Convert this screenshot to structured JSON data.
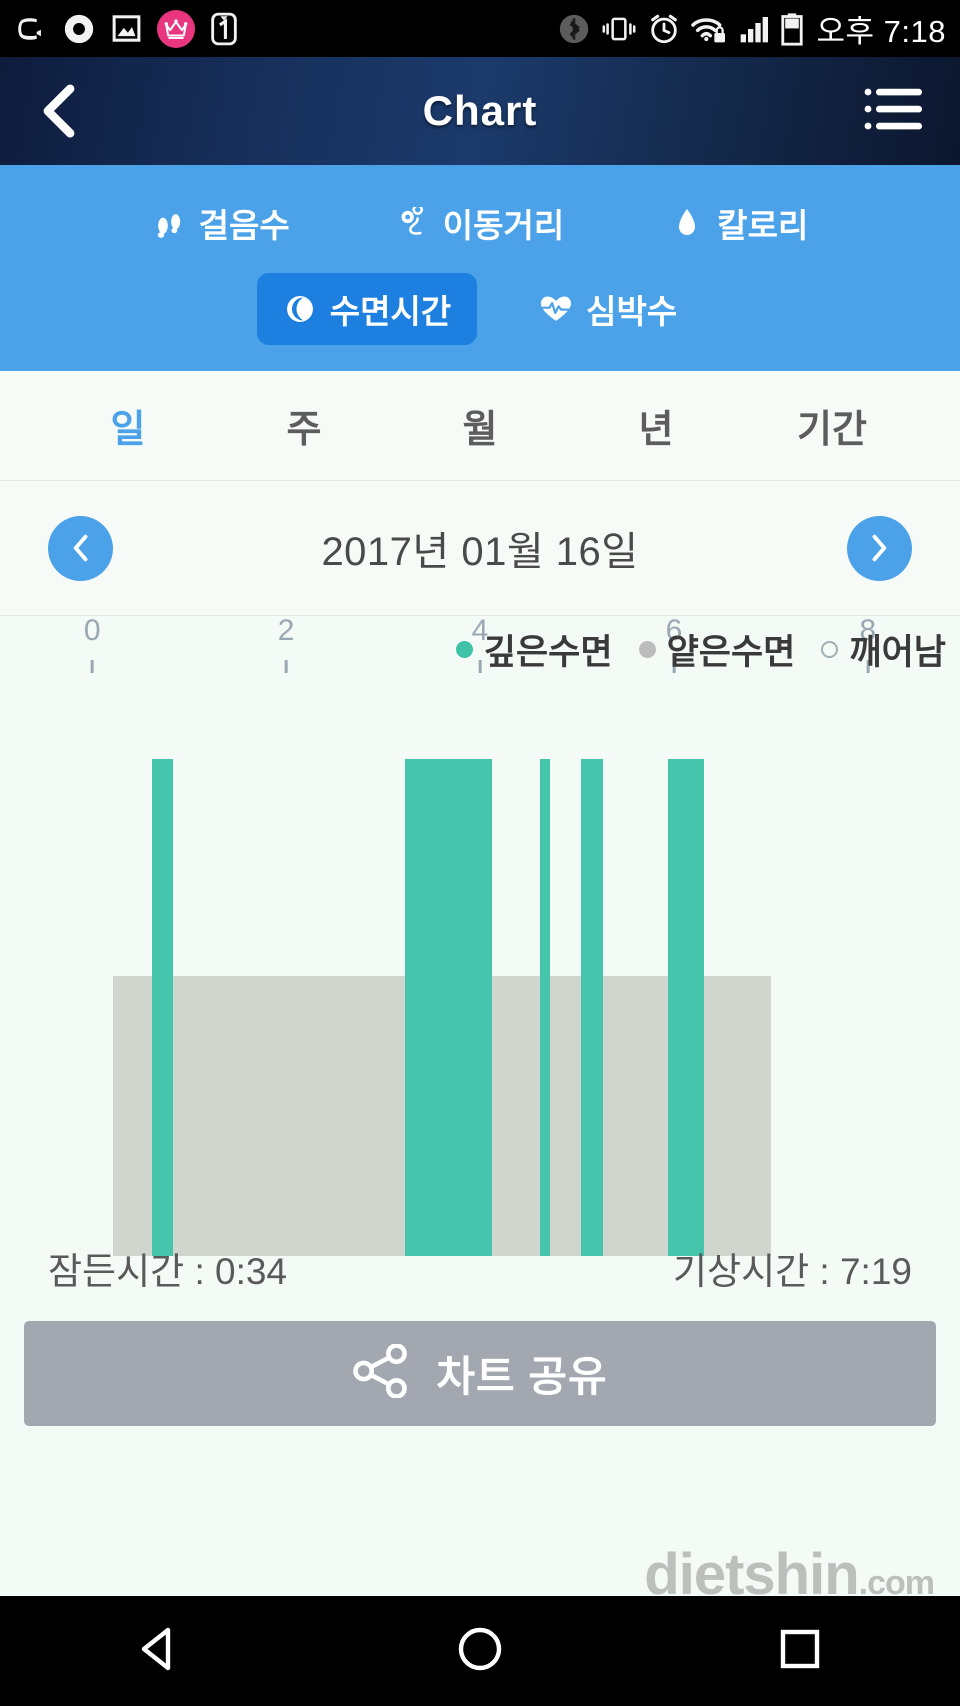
{
  "statusbar": {
    "icons_left": [
      "usb-icon",
      "record-icon",
      "gallery-icon",
      "crown-icon",
      "one-app-icon"
    ],
    "icons_right": [
      "bluetooth-icon",
      "vibrate-icon",
      "alarm-icon",
      "wifi-lock-icon",
      "signal-icon",
      "battery-icon"
    ],
    "time": "오후 7:18"
  },
  "appbar": {
    "title": "Chart",
    "back_icon": "back-chevron-icon",
    "menu_icon": "list-menu-icon"
  },
  "metrics": {
    "row1": [
      {
        "label": "걸음수",
        "icon": "footsteps-icon",
        "selected": false
      },
      {
        "label": "이동거리",
        "icon": "location-pin-icon",
        "selected": false
      },
      {
        "label": "칼로리",
        "icon": "flame-icon",
        "selected": false
      }
    ],
    "row2": [
      {
        "label": "수면시간",
        "icon": "moon-icon",
        "selected": true
      },
      {
        "label": "심박수",
        "icon": "heart-pulse-icon",
        "selected": false
      }
    ],
    "bg_color": "#4ca2e8",
    "selected_color": "#1d7fe0"
  },
  "periods": [
    {
      "label": "일",
      "active": true
    },
    {
      "label": "주",
      "active": false
    },
    {
      "label": "월",
      "active": false
    },
    {
      "label": "년",
      "active": false
    },
    {
      "label": "기간",
      "active": false
    }
  ],
  "date_nav": {
    "prev_icon": "chevron-left-icon",
    "next_icon": "chevron-right-icon",
    "date": "2017년 01월 16일"
  },
  "chart_data": {
    "type": "bar",
    "title": "",
    "xlabel": "",
    "ylabel": "",
    "xlim": [
      0,
      8
    ],
    "ticks": [
      0,
      2,
      4,
      6,
      8
    ],
    "tick_labels": [
      "0",
      "2",
      "4",
      "6",
      "8"
    ],
    "grid": false,
    "legend_position": "top-right",
    "legend": [
      {
        "name": "깊은수면",
        "color": "#3fc2a7",
        "style": "filled"
      },
      {
        "name": "얕은수면",
        "color": "#bcbcbc",
        "style": "filled"
      },
      {
        "name": "깨어남",
        "color": "#9fb0b5",
        "style": "hollow"
      }
    ],
    "series": [
      {
        "name": "얕은수면",
        "color": "#d0d5ce",
        "height_ratio": 0.62,
        "segments": [
          {
            "start": 0.22,
            "end": 7.0
          }
        ]
      },
      {
        "name": "깊은수면",
        "color": "#45c5ab",
        "height_ratio": 1.0,
        "segments": [
          {
            "start": 0.62,
            "end": 0.83
          },
          {
            "start": 3.23,
            "end": 4.12
          },
          {
            "start": 4.62,
            "end": 4.72
          },
          {
            "start": 5.04,
            "end": 5.27
          },
          {
            "start": 5.94,
            "end": 6.31
          }
        ]
      }
    ],
    "annotations": {
      "sleep_start_label": "잠든시간 : 0:34",
      "wake_label": "기상시간 : 7:19"
    }
  },
  "footer": {
    "sleep_time": "잠든시간 : 0:34",
    "wake_time": "기상시간 : 7:19"
  },
  "share": {
    "label": "차트 공유",
    "icon": "share-nodes-icon",
    "color": "#a3a8b0"
  },
  "watermark": {
    "brand": "dietshin",
    "domain": ".com"
  },
  "navbar": {
    "back_icon": "nav-back-triangle-icon",
    "home_icon": "nav-home-circle-icon",
    "recents_icon": "nav-recents-square-icon"
  }
}
